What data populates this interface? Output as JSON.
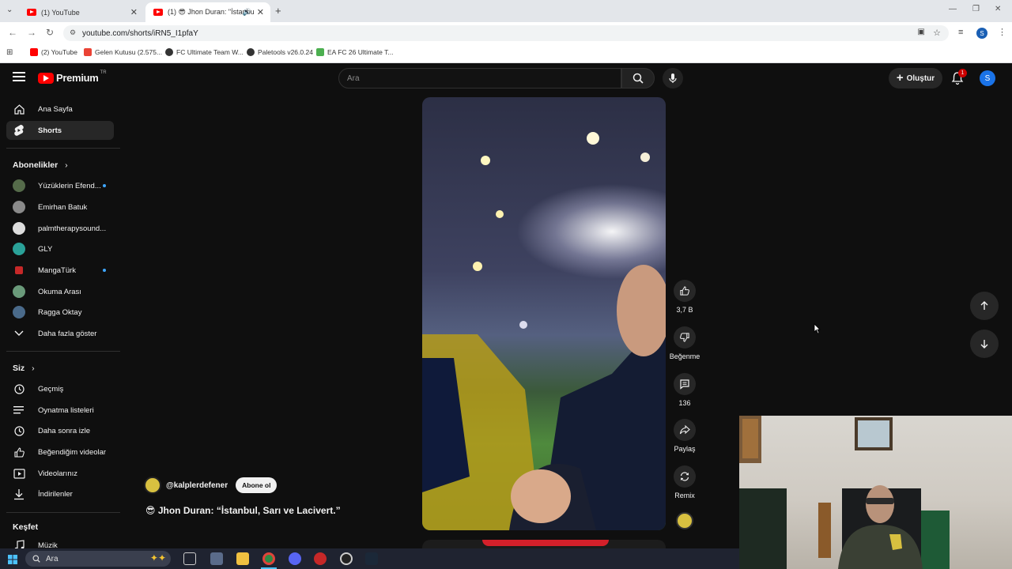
{
  "browser": {
    "tabs": [
      {
        "title": "(1) YouTube"
      },
      {
        "title": "(1) 😎 Jhon Duran: \"İstanbu"
      }
    ],
    "url": "youtube.com/shorts/iRN5_I1pfaY",
    "bookmarks": [
      {
        "label": "(2) YouTube",
        "color": "#ff0000"
      },
      {
        "label": "Gelen Kutusu (2.575...",
        "color": "#ea4335"
      },
      {
        "label": "FC Ultimate Team W...",
        "color": "#333333"
      },
      {
        "label": "Paletools v26.0.24",
        "color": "#333333"
      },
      {
        "label": "EA FC 26 Ultimate T...",
        "color": "#4caf50"
      }
    ]
  },
  "header": {
    "logo_text": "Premium",
    "logo_badge": "TR",
    "search_placeholder": "Ara",
    "create_label": "Oluştur",
    "notification_count": "1",
    "avatar_letter": "S"
  },
  "sidebar": {
    "main": [
      {
        "label": "Ana Sayfa",
        "icon": "home-icon"
      },
      {
        "label": "Shorts",
        "icon": "shorts-icon",
        "selected": true
      }
    ],
    "subscriptions_title": "Abonelikler",
    "subscriptions": [
      {
        "label": "Yüzüklerin Efend...",
        "color": "#556b4a",
        "live": true
      },
      {
        "label": "Emirhan Batuk",
        "color": "#8a8a8a",
        "live": false
      },
      {
        "label": "palmtherapysound...",
        "color": "#dddddd",
        "live": false
      },
      {
        "label": "GLY",
        "color": "#2aa198",
        "live": false
      },
      {
        "label": "MangaTürk",
        "color": "#c62828",
        "live": true
      },
      {
        "label": "Okuma Arası",
        "color": "#6a9a7a",
        "live": false
      },
      {
        "label": "Ragga Oktay",
        "color": "#4a6a8a",
        "live": false
      }
    ],
    "show_more": "Daha fazla göster",
    "you_title": "Siz",
    "you_items": [
      {
        "label": "Geçmiş",
        "icon": "history-icon"
      },
      {
        "label": "Oynatma listeleri",
        "icon": "playlists-icon"
      },
      {
        "label": "Daha sonra izle",
        "icon": "watch-later-icon"
      },
      {
        "label": "Beğendiğim videolar",
        "icon": "liked-videos-icon"
      },
      {
        "label": "Videolarınız",
        "icon": "your-videos-icon"
      },
      {
        "label": "İndirilenler",
        "icon": "downloads-icon"
      }
    ],
    "explore_title": "Keşfet",
    "explore_items": [
      {
        "label": "Müzik",
        "icon": "music-icon"
      }
    ]
  },
  "short": {
    "channel": "@kalplerdefener",
    "subscribe_label": "Abone ol",
    "title": "😎 Jhon Duran: “İstanbul, Sarı ve Lacivert.”",
    "actions": {
      "like_count": "3,7 B",
      "dislike_label": "Beğenme",
      "comment_count": "136",
      "share_label": "Paylaş",
      "remix_label": "Remix"
    }
  },
  "taskbar": {
    "search_placeholder": "Ara"
  }
}
